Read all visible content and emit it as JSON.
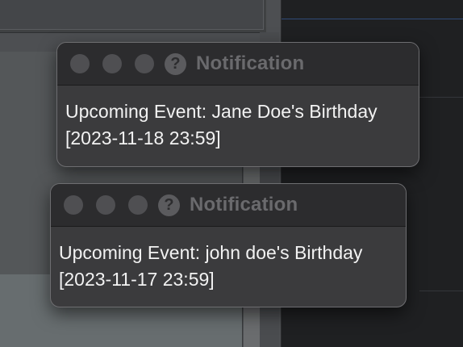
{
  "notifications": [
    {
      "title": "Notification",
      "help_glyph": "?",
      "message": "Upcoming Event: Jane Doe's Birthday",
      "datetime": "[2023-11-18 23:59]"
    },
    {
      "title": "Notification",
      "help_glyph": "?",
      "message": "Upcoming Event: john doe's Birthday",
      "datetime": "[2023-11-17 23:59]"
    }
  ],
  "colors": {
    "window_bg": "#3b3b3d",
    "titlebar_bg": "#2c2c2e",
    "traffic_light_inactive": "#4f4f52",
    "title_text": "#6a6a6d",
    "body_text": "#f2f2f2"
  },
  "icons": {
    "window_controls": [
      "close-icon",
      "minimize-icon",
      "zoom-icon"
    ],
    "help": "help-icon"
  }
}
